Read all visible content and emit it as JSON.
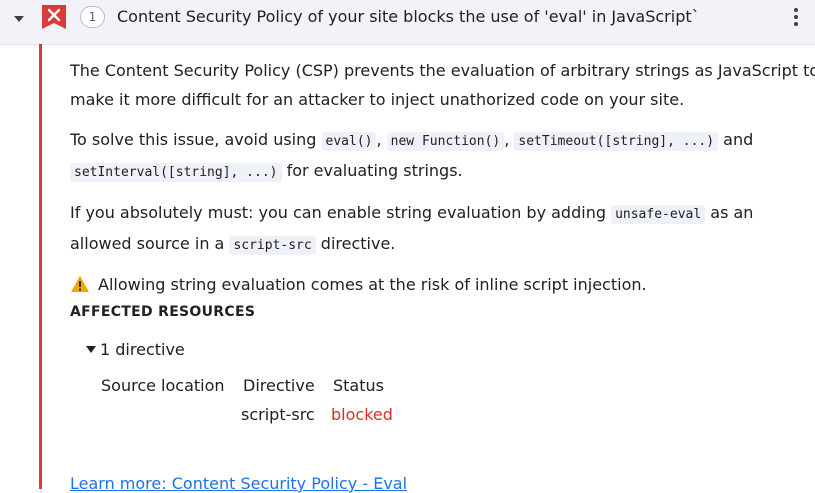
{
  "issue": {
    "count": "1",
    "title": "Content Security Policy of your site blocks the use of 'eval' in JavaScript`"
  },
  "body": {
    "p1_line1": "The Content Security Policy (CSP) prevents the evaluation of arbitrary strings as JavaScript to",
    "p1_line2": "make it more difficult for an attacker to inject unathorized code on your site.",
    "p2_text1": "To solve this issue, avoid using ",
    "p2_code1": "eval()",
    "p2_sep1": ", ",
    "p2_code2": "new Function()",
    "p2_sep2": ", ",
    "p2_code3": "setTimeout([string], ...)",
    "p2_text2": " and",
    "p2_code4": "setInterval([string], ...)",
    "p2_text3": " for evaluating strings.",
    "p3_text1": "If you absolutely must: you can enable string evaluation by adding ",
    "p3_code1": "unsafe-eval",
    "p3_text2": " as an",
    "p3_text3": "allowed source in a ",
    "p3_code2": "script-src",
    "p3_text4": " directive.",
    "warning": "Allowing string evaluation comes at the risk of inline script injection."
  },
  "affected": {
    "heading": "AFFECTED RESOURCES",
    "toggle_label": "1 directive",
    "columns": [
      "Source location",
      "Directive",
      "Status"
    ],
    "row": {
      "directive": "script-src",
      "status": "blocked"
    }
  },
  "learn_more": "Learn more: Content Security Policy - Eval",
  "colors": {
    "error": "#dc3a3a",
    "link": "#1a73e8",
    "blocked": "#d93025",
    "header_bg": "#f1f3f8"
  },
  "icons": [
    "chevron-down-icon",
    "error-flag-icon",
    "more-vert-icon",
    "warning-icon"
  ]
}
